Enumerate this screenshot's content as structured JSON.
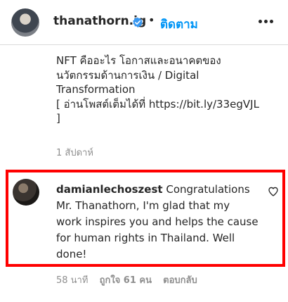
{
  "header": {
    "username": "thanathorn.ig",
    "separator": "•",
    "follow_label": "ติดตาม"
  },
  "caption": {
    "line1": "NFT คืออะไร โอกาสและอนาคตของ",
    "line2": "นวัตกรรมด้านการเงิน / Digital",
    "line3": "Transformation",
    "line4": "[ อ่านโพสต์เต็มได้ที่ https://bit.ly/33egVJL",
    "line5": "]",
    "time": "1 สัปดาห์"
  },
  "comment": {
    "username": "damianlechoszest",
    "text": "Congratulations Mr. Thanathorn, I'm glad that my work inspires you and helps the cause for human rights in Thailand. Well done!",
    "time": "58 นาที",
    "likes": "ถูกใจ 61 คน",
    "reply_label": "ตอบกลับ"
  },
  "colors": {
    "accent": "#0095f6",
    "highlight": "#ff0000",
    "muted": "#8e8e8e"
  },
  "icons": {
    "verified": "verified-badge-icon",
    "more": "more-options-icon",
    "like": "heart-icon"
  }
}
